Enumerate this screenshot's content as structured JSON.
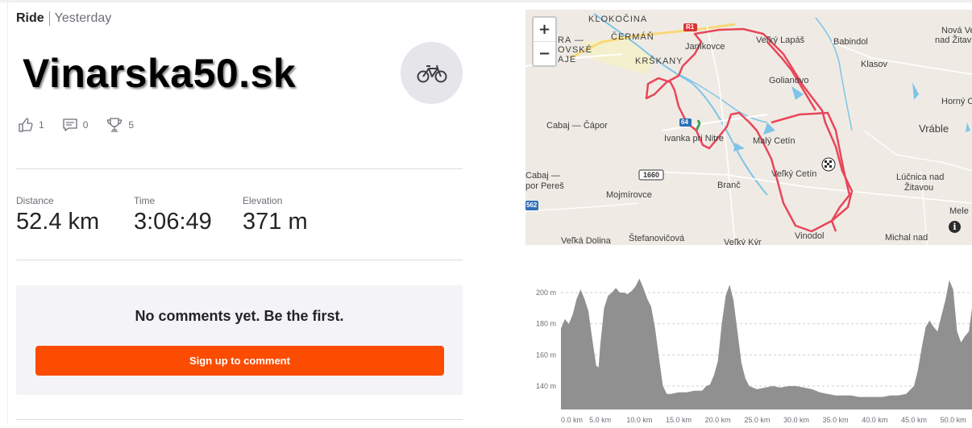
{
  "activity": {
    "type": "Ride",
    "when": "Yesterday",
    "title": "Vinarska50.sk",
    "sport_icon": "bike-icon"
  },
  "social": {
    "kudos_count": "1",
    "comment_count": "0",
    "achievement_count": "5"
  },
  "stats": [
    {
      "label": "Distance",
      "value": "52.4 km"
    },
    {
      "label": "Time",
      "value": "3:06:49"
    },
    {
      "label": "Elevation",
      "value": "371 m"
    }
  ],
  "comments": {
    "empty_message": "No comments yet. Be the first.",
    "signup_label": "Sign up to comment"
  },
  "map": {
    "zoom_in": "+",
    "zoom_out": "−",
    "info": "i",
    "labels": [
      "KLOKOČINA",
      "ČERMÁŇ",
      "KRŠKANY",
      "Janíkovce",
      "Veľký Lapáš",
      "Babindol",
      "Nová Ve",
      "nad Žitav",
      "Klasov",
      "Golianovo",
      "Horný Oha",
      "Vráble",
      "Cabaj — Čápor",
      "Ivanka pri Nitre",
      "Malý Cetín",
      "Veľký Cetín",
      "Cabaj —",
      "por Pereš",
      "Mojmírovce",
      "Branč",
      "Lúčnica nad",
      "Žitavou",
      "Mele",
      "Veľká Dolina",
      "Štefanovičová",
      "Veľký Kýr",
      "Vinodol",
      "Michal nad",
      "RA —",
      "OVSKÉ",
      "AJE"
    ],
    "road_badges": [
      "R1",
      "64",
      "1660",
      "562"
    ]
  },
  "chart_data": {
    "type": "area",
    "title": "",
    "xlabel": "",
    "ylabel": "",
    "x_unit": "km",
    "y_unit": "m",
    "xlim": [
      0,
      52.4
    ],
    "ylim": [
      125,
      215
    ],
    "y_ticks": [
      "140 m",
      "160 m",
      "180 m",
      "200 m"
    ],
    "x_ticks": [
      "0.0 km",
      "5.0 km",
      "10.0 km",
      "15.0 km",
      "20.0 km",
      "25.0 km",
      "30.0 km",
      "35.0 km",
      "40.0 km",
      "45.0 km",
      "50.0 km"
    ],
    "fill_color": "#909090",
    "grid": true,
    "points": [
      [
        0,
        177
      ],
      [
        0.5,
        183
      ],
      [
        1,
        180
      ],
      [
        1.5,
        186
      ],
      [
        2,
        196
      ],
      [
        2.5,
        202
      ],
      [
        3,
        196
      ],
      [
        3.5,
        188
      ],
      [
        4,
        170
      ],
      [
        4.5,
        153
      ],
      [
        4.8,
        152
      ],
      [
        5,
        166
      ],
      [
        5.5,
        190
      ],
      [
        6,
        198
      ],
      [
        6.5,
        200
      ],
      [
        7,
        203
      ],
      [
        7.5,
        200
      ],
      [
        8,
        200
      ],
      [
        8.5,
        199
      ],
      [
        9,
        201
      ],
      [
        9.5,
        204
      ],
      [
        10,
        209
      ],
      [
        10.5,
        203
      ],
      [
        11,
        196
      ],
      [
        11.5,
        191
      ],
      [
        12,
        177
      ],
      [
        12.5,
        158
      ],
      [
        13,
        140
      ],
      [
        13.5,
        135
      ],
      [
        14,
        135
      ],
      [
        15,
        136
      ],
      [
        16,
        136
      ],
      [
        17,
        137
      ],
      [
        18,
        137
      ],
      [
        18.5,
        140
      ],
      [
        19,
        141
      ],
      [
        19.5,
        147
      ],
      [
        20,
        156
      ],
      [
        20.5,
        180
      ],
      [
        21,
        198
      ],
      [
        21.5,
        205
      ],
      [
        22,
        195
      ],
      [
        22.5,
        175
      ],
      [
        23,
        155
      ],
      [
        23.5,
        145
      ],
      [
        24,
        140
      ],
      [
        25,
        138
      ],
      [
        26,
        139
      ],
      [
        27,
        140
      ],
      [
        28,
        139
      ],
      [
        29,
        140
      ],
      [
        30,
        140
      ],
      [
        31,
        139
      ],
      [
        32,
        138
      ],
      [
        33,
        136
      ],
      [
        34,
        135
      ],
      [
        35,
        134
      ],
      [
        36,
        134
      ],
      [
        37,
        134
      ],
      [
        38,
        133
      ],
      [
        39,
        133
      ],
      [
        40,
        133
      ],
      [
        41,
        133
      ],
      [
        42,
        134
      ],
      [
        43,
        134
      ],
      [
        44,
        135
      ],
      [
        45,
        140
      ],
      [
        45.5,
        150
      ],
      [
        46,
        165
      ],
      [
        46.5,
        178
      ],
      [
        47,
        182
      ],
      [
        47.5,
        178
      ],
      [
        48,
        175
      ],
      [
        48.5,
        185
      ],
      [
        49,
        195
      ],
      [
        49.5,
        208
      ],
      [
        50,
        202
      ],
      [
        50.5,
        175
      ],
      [
        51,
        168
      ],
      [
        51.5,
        172
      ],
      [
        52,
        175
      ],
      [
        52.4,
        190
      ]
    ]
  }
}
